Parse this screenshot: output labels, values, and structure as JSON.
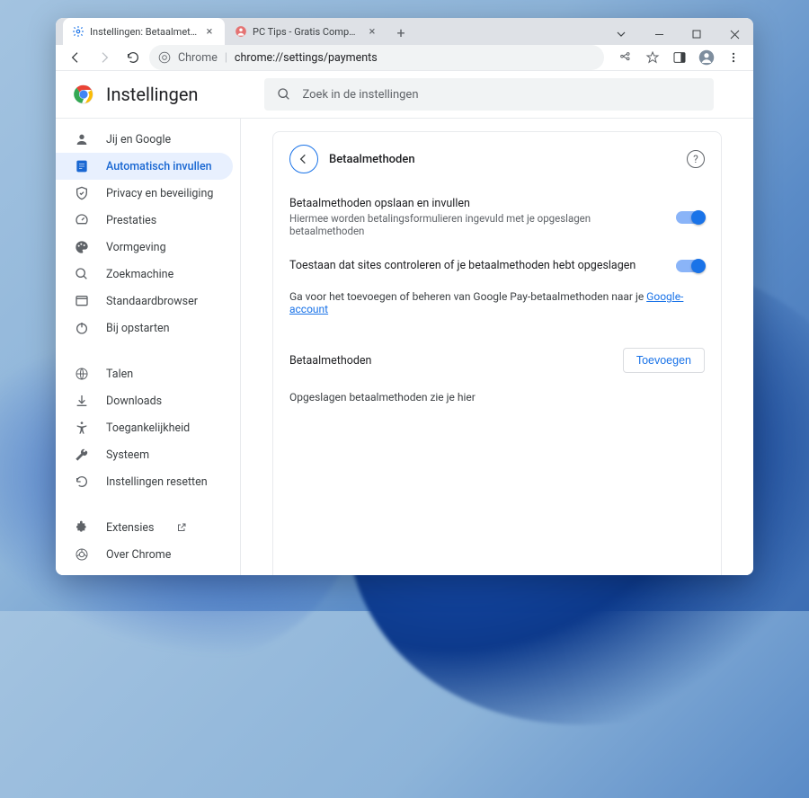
{
  "tabs": [
    {
      "title": "Instellingen: Betaalmethoden",
      "active": true
    },
    {
      "title": "PC Tips - Gratis Computer Tips, k",
      "active": false
    }
  ],
  "addressbar": {
    "prefix": "Chrome",
    "url": "chrome://settings/payments"
  },
  "header": {
    "title": "Instellingen",
    "search_placeholder": "Zoek in de instellingen"
  },
  "sidebar_main": [
    {
      "id": "you-google",
      "label": "Jij en Google"
    },
    {
      "id": "autofill",
      "label": "Automatisch invullen",
      "active": true
    },
    {
      "id": "privacy",
      "label": "Privacy en beveiliging"
    },
    {
      "id": "performance",
      "label": "Prestaties"
    },
    {
      "id": "appearance",
      "label": "Vormgeving"
    },
    {
      "id": "search",
      "label": "Zoekmachine"
    },
    {
      "id": "default-browser",
      "label": "Standaardbrowser"
    },
    {
      "id": "on-startup",
      "label": "Bij opstarten"
    }
  ],
  "sidebar_more": [
    {
      "id": "languages",
      "label": "Talen"
    },
    {
      "id": "downloads",
      "label": "Downloads"
    },
    {
      "id": "accessibility",
      "label": "Toegankelijkheid"
    },
    {
      "id": "system",
      "label": "Systeem"
    },
    {
      "id": "reset",
      "label": "Instellingen resetten"
    }
  ],
  "sidebar_bottom": [
    {
      "id": "extensions",
      "label": "Extensies",
      "external": true
    },
    {
      "id": "about",
      "label": "Over Chrome"
    }
  ],
  "panel": {
    "title": "Betaalmethoden",
    "settings": [
      {
        "title": "Betaalmethoden opslaan en invullen",
        "subtitle": "Hiermee worden betalingsformulieren ingevuld met je opgeslagen betaalmethoden",
        "enabled": true
      },
      {
        "title": "Toestaan dat sites controleren of je betaalmethoden hebt opgeslagen",
        "subtitle": "",
        "enabled": true
      }
    ],
    "note_prefix": "Ga voor het toevoegen of beheren van Google Pay-betaalmethoden naar je ",
    "note_link": "Google-account",
    "section_title": "Betaalmethoden",
    "add_button": "Toevoegen",
    "empty_message": "Opgeslagen betaalmethoden zie je hier"
  }
}
